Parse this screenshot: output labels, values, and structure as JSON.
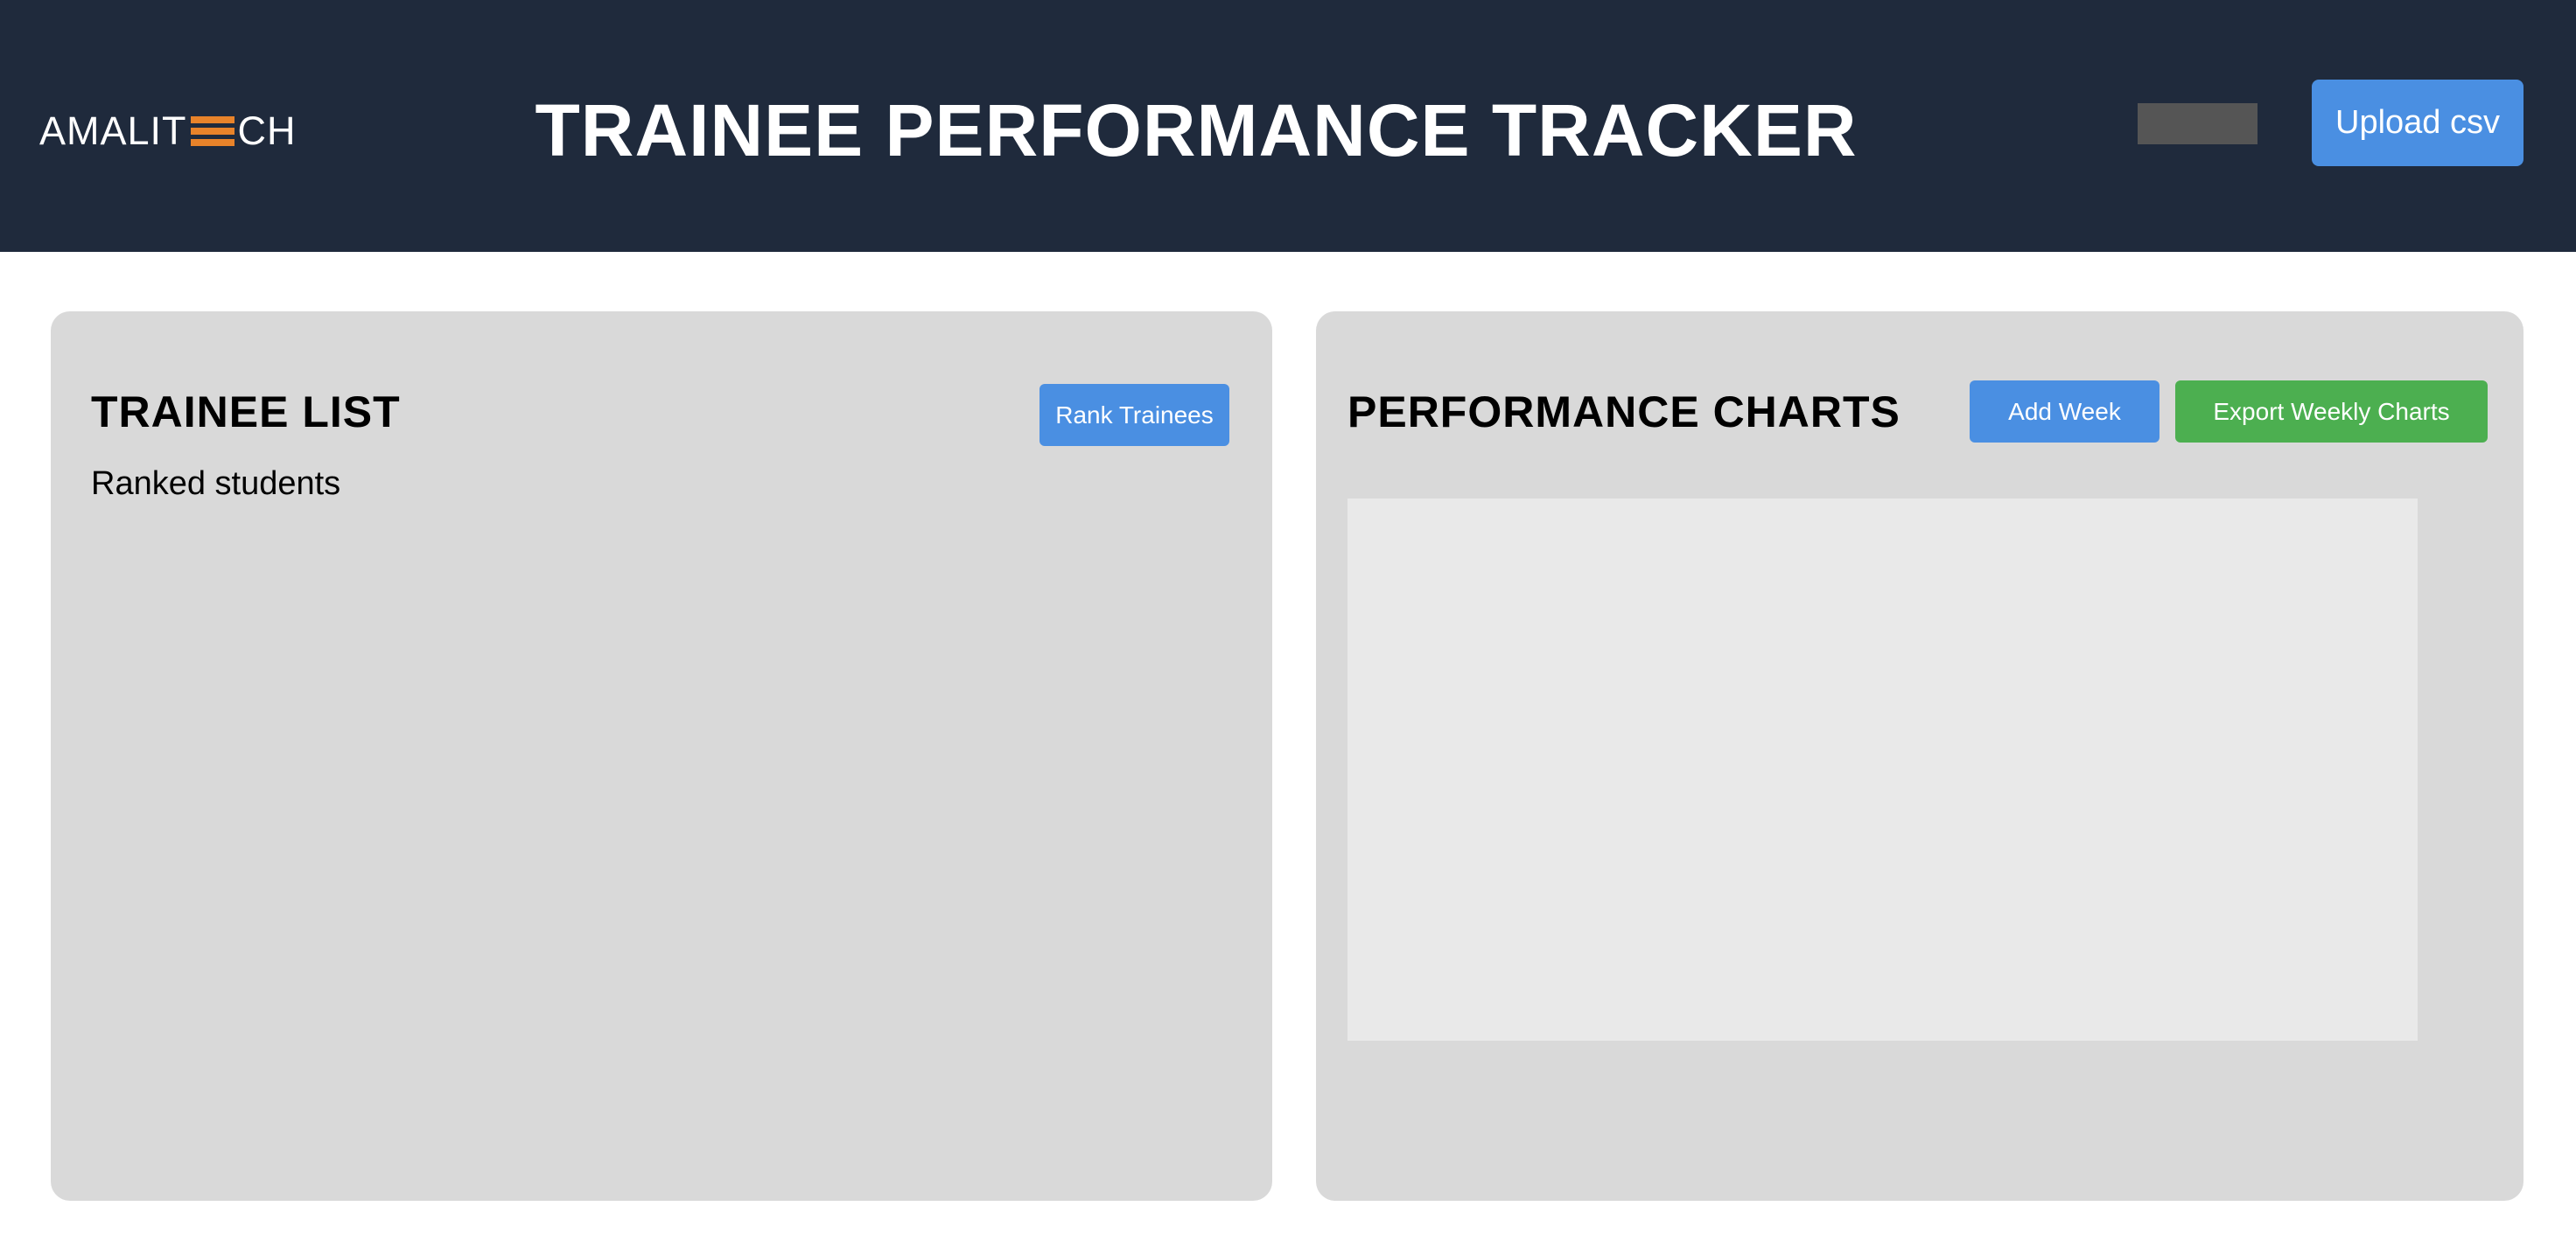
{
  "header": {
    "logo": {
      "text_before": "AMALIT",
      "text_after": "CH",
      "mark_icon": "three-bars-logo-mark",
      "mark_color": "#e8832a"
    },
    "title": "TRAINEE PERFORMANCE TRACKER",
    "upload_label": "Upload csv",
    "background": "#1f2a3c"
  },
  "trainee_list": {
    "heading": "TRAINEE LIST",
    "rank_button_label": "Rank Trainees",
    "subtitle": "Ranked students"
  },
  "performance_charts": {
    "heading": "PERFORMANCE CHARTS",
    "add_week_label": "Add Week",
    "export_label": "Export Weekly Charts"
  },
  "colors": {
    "primary_button": "#4a8fe2",
    "export_button": "#4caf50",
    "panel_background": "#d9d9d9",
    "chart_background": "#e9e9e9"
  }
}
